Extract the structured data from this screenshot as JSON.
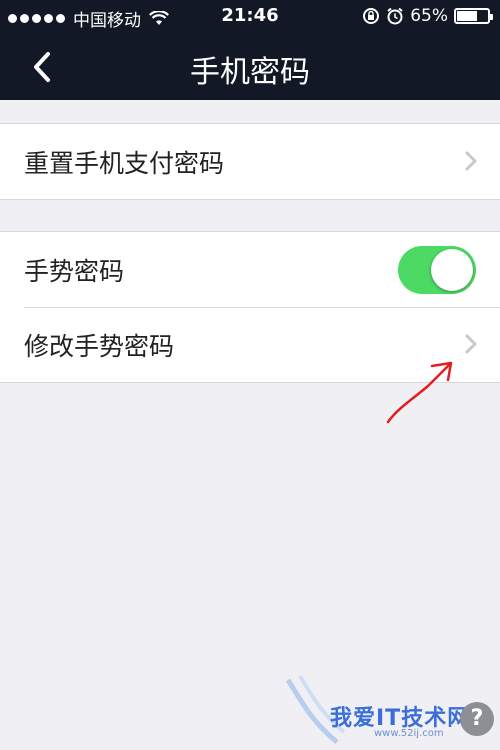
{
  "status_bar": {
    "carrier": "中国移动",
    "time": "21:46",
    "battery": "65%",
    "battery_fraction": 0.65,
    "signal_icon": "signal-dots-icon",
    "wifi_icon": "wifi-icon",
    "lock_icon": "rotation-lock-icon",
    "alarm_icon": "alarm-icon"
  },
  "nav": {
    "title": "手机密码",
    "back_icon": "chevron-left-icon"
  },
  "settings": {
    "reset_pay_password": "重置手机支付密码",
    "gesture_password": "手势密码",
    "gesture_password_enabled": true,
    "change_gesture_password": "修改手势密码"
  },
  "watermark": {
    "text": "我爱IT技术网",
    "url": "www.52ij.com"
  },
  "colors": {
    "bar_bg": "#131826",
    "page_bg": "#efeff4",
    "toggle_on": "#4cd964",
    "chevron": "#c7c7cc",
    "annotation_arrow": "#e02020"
  }
}
